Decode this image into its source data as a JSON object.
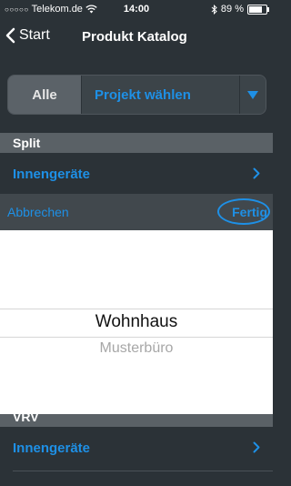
{
  "status_bar": {
    "carrier": "Telekom.de",
    "time": "14:00",
    "battery_percent_label": "89 %",
    "battery_level": 0.89
  },
  "nav": {
    "back_label": "Start",
    "title": "Produkt Katalog"
  },
  "filter": {
    "all_label": "Alle",
    "project_label": "Projekt wählen"
  },
  "sections": [
    {
      "header": "Split",
      "row_label": "Innengeräte"
    },
    {
      "header": "VRV",
      "row_label": "Innengeräte"
    }
  ],
  "picker": {
    "cancel_label": "Abbrechen",
    "done_label": "Fertig",
    "selected_option": "Wohnhaus",
    "next_option": "Musterbüro"
  },
  "colors": {
    "accent_blue": "#1e90e6",
    "background": "#2b3237",
    "section_header": "#5a6166"
  }
}
